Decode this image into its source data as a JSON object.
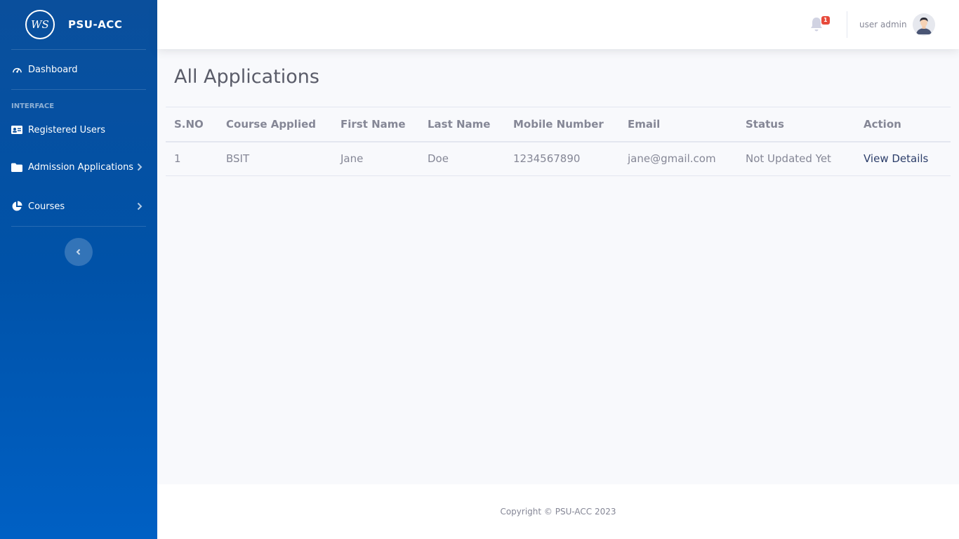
{
  "brand": {
    "logo_text": "WS",
    "name": "PSU-ACC"
  },
  "sidebar": {
    "dashboard_label": "Dashboard",
    "heading": "INTERFACE",
    "items": [
      {
        "label": "Registered Users",
        "icon": "id-card-icon"
      },
      {
        "label": "Admission Applications",
        "icon": "folder-icon"
      },
      {
        "label": "Courses",
        "icon": "pie-chart-icon"
      }
    ]
  },
  "topbar": {
    "notification_count": "1",
    "user_name": "user admin"
  },
  "page": {
    "title": "All Applications"
  },
  "table": {
    "headers": [
      "S.NO",
      "Course Applied",
      "First Name",
      "Last Name",
      "Mobile Number",
      "Email",
      "Status",
      "Action"
    ],
    "rows": [
      [
        "1",
        "BSIT",
        "Jane",
        "Doe",
        "1234567890",
        "jane@gmail.com",
        "Not Updated Yet",
        "View Details"
      ]
    ]
  },
  "footer": {
    "copyright": "Copyright © PSU-ACC 2023"
  },
  "colors": {
    "sidebar_top": "#0a4f9c",
    "sidebar_bottom": "#0060c4",
    "badge": "#e74a3b",
    "link": "#2c3e6a"
  }
}
